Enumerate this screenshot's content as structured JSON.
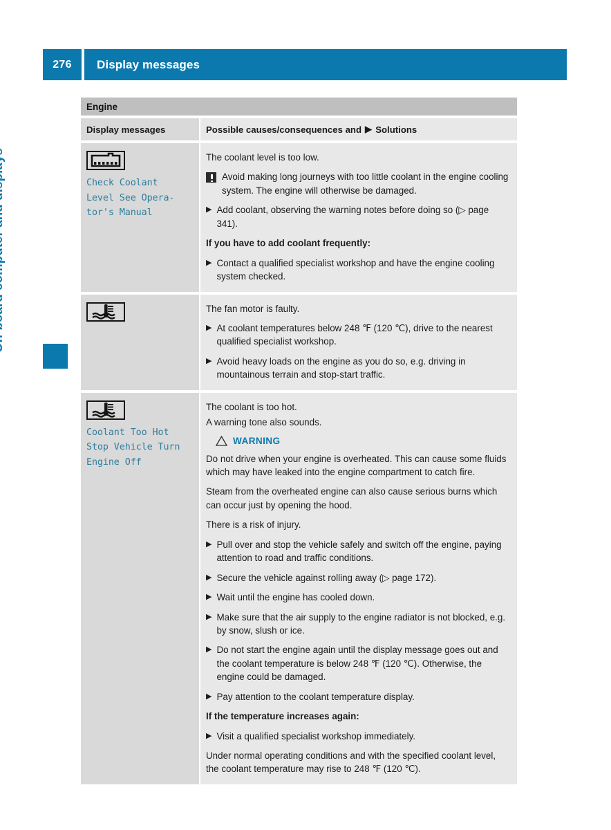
{
  "header": {
    "page_number": "276",
    "title": "Display messages"
  },
  "side": {
    "chapter_title": "On-board computer and displays"
  },
  "table": {
    "section_title": "Engine",
    "columns": {
      "left": "Display messages",
      "right_prefix": "Possible causes/consequences and",
      "right_suffix": "Solutions",
      "right_arrow": "▶"
    },
    "rows": [
      {
        "icon_name": "coolant-tank-icon",
        "message": "Check Coolant\nLevel See Opera-\ntor's Manual",
        "blocks": [
          {
            "type": "p",
            "text": "The coolant level is too low."
          },
          {
            "type": "note",
            "text": "Avoid making long journeys with too little coolant in the engine cooling system. The engine will otherwise be damaged."
          },
          {
            "type": "bullet",
            "text": "Add coolant, observing the warning notes before doing so (▷ page 341)."
          },
          {
            "type": "bold",
            "text": "If you have to add coolant frequently:"
          },
          {
            "type": "bullet",
            "text": "Contact a qualified specialist workshop and have the engine cooling system checked."
          }
        ]
      },
      {
        "icon_name": "coolant-temp-icon",
        "message": "",
        "blocks": [
          {
            "type": "p",
            "text": "The fan motor is faulty."
          },
          {
            "type": "bullet",
            "text": "At coolant temperatures below 248 ℉ (120 ℃), drive to the nearest qualified specialist workshop."
          },
          {
            "type": "bullet",
            "text": "Avoid heavy loads on the engine as you do so, e.g. driving in mountainous terrain and stop-start traffic."
          }
        ]
      },
      {
        "icon_name": "coolant-temp-icon",
        "message": "Coolant Too Hot\nStop Vehicle Turn\nEngine Off",
        "blocks": [
          {
            "type": "p-tight",
            "text": "The coolant is too hot."
          },
          {
            "type": "p",
            "text": "A warning tone also sounds."
          },
          {
            "type": "warning",
            "text": "WARNING"
          },
          {
            "type": "p",
            "text": "Do not drive when your engine is overheated. This can cause some fluids which may have leaked into the engine compartment to catch fire."
          },
          {
            "type": "p",
            "text": "Steam from the overheated engine can also cause serious burns which can occur just by opening the hood."
          },
          {
            "type": "p",
            "text": "There is a risk of injury."
          },
          {
            "type": "bullet",
            "text": "Pull over and stop the vehicle safely and switch off the engine, paying attention to road and traffic conditions."
          },
          {
            "type": "bullet",
            "text": "Secure the vehicle against rolling away (▷ page 172)."
          },
          {
            "type": "bullet",
            "text": "Wait until the engine has cooled down."
          },
          {
            "type": "bullet",
            "text": "Make sure that the air supply to the engine radiator is not blocked, e.g. by snow, slush or ice."
          },
          {
            "type": "bullet",
            "text": "Do not start the engine again until the display message goes out and the coolant temperature is below 248 ℉ (120 ℃). Otherwise, the engine could be damaged."
          },
          {
            "type": "bullet",
            "text": "Pay attention to the coolant temperature display."
          },
          {
            "type": "bold",
            "text": "If the temperature increases again:"
          },
          {
            "type": "bullet",
            "text": "Visit a qualified specialist workshop immediately."
          },
          {
            "type": "p-last",
            "text": "Under normal operating conditions and with the specified coolant level, the coolant temperature may rise to 248 ℉ (120 ℃)."
          }
        ]
      }
    ]
  },
  "colors": {
    "accent": "#0b79ae",
    "message_text": "#2f7e9e",
    "section_header_bg": "#bfbfbf",
    "left_cell_bg": "#d9d9d9",
    "right_cell_bg": "#e8e8e8"
  }
}
